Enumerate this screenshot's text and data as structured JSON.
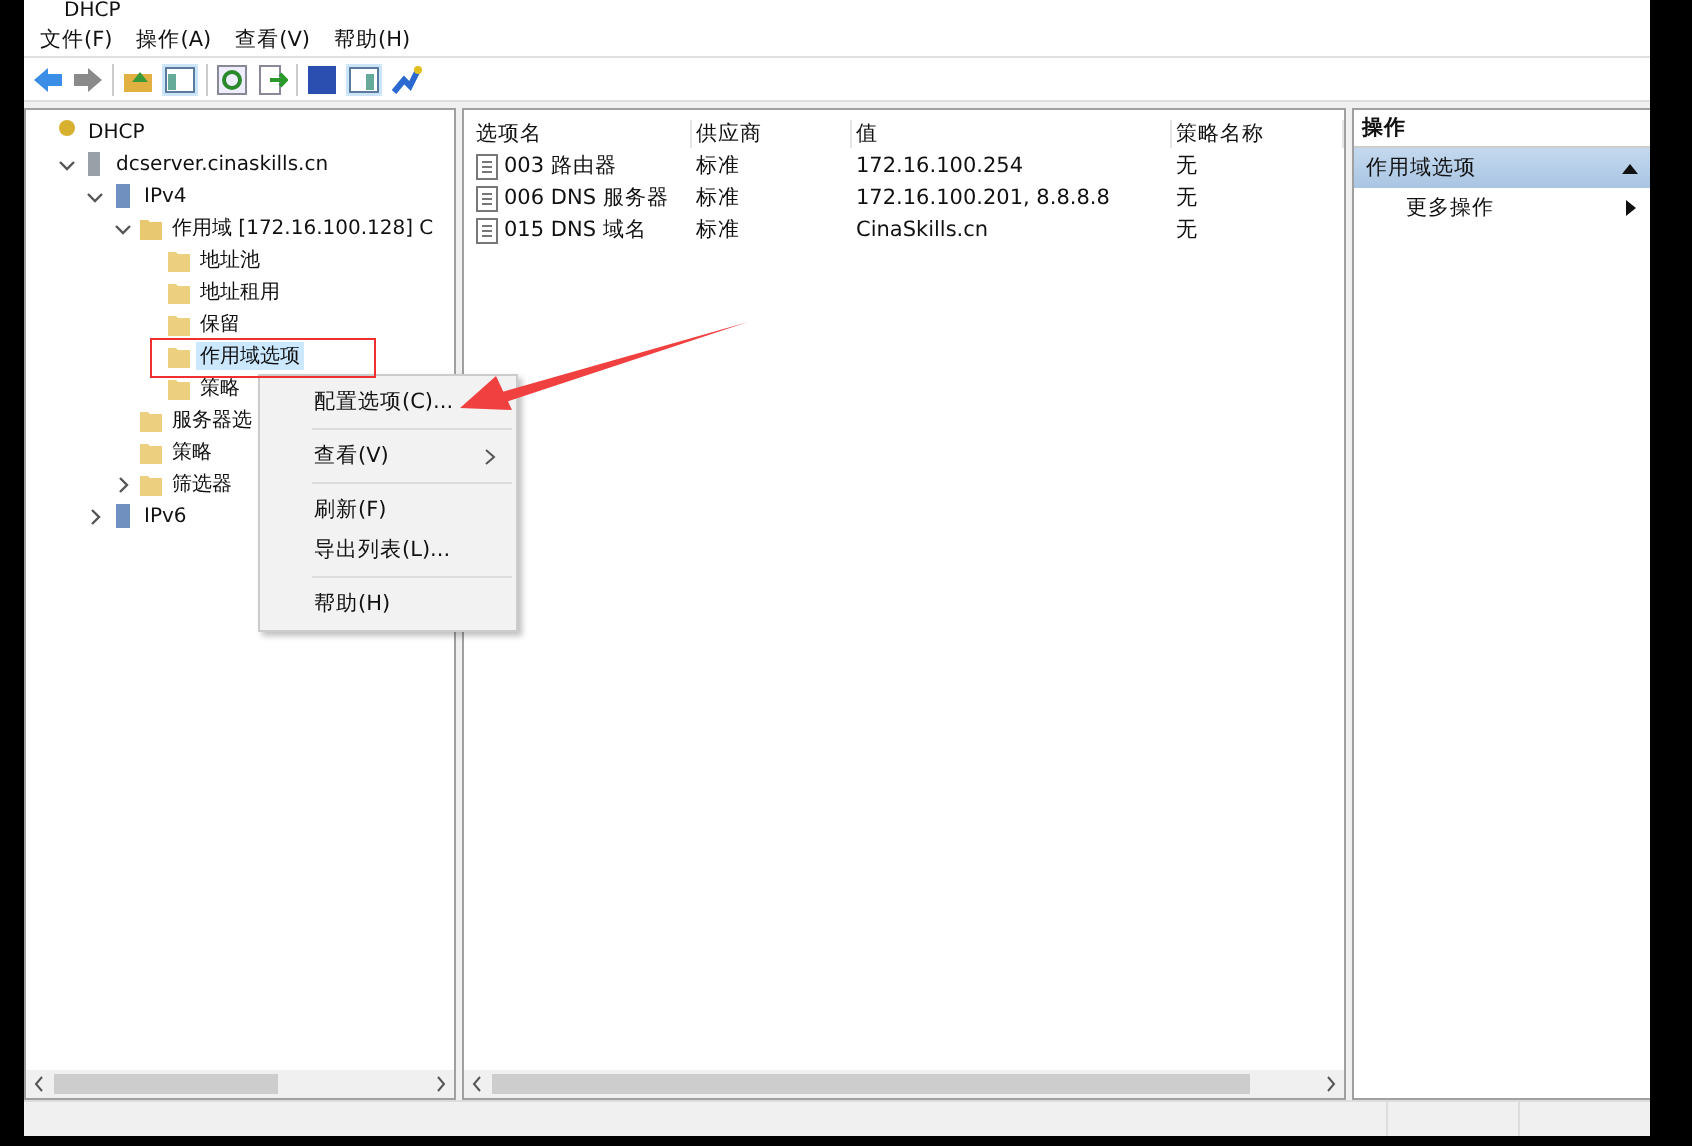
{
  "window": {
    "title": "DHCP"
  },
  "menu": [
    "文件(F)",
    "操作(A)",
    "查看(V)",
    "帮助(H)"
  ],
  "tree": [
    {
      "label": "DHCP",
      "kind": "root",
      "selected": false,
      "children": [
        {
          "label": "dcserver.cinaskills.cn",
          "kind": "server",
          "selected": false,
          "expanded": true,
          "children": [
            {
              "label": "IPv4",
              "kind": "protocol",
              "selected": false,
              "expanded": true,
              "children": [
                {
                  "label": "作用域 [172.16.100.128] C",
                  "kind": "scope",
                  "selected": false,
                  "expanded": true,
                  "children": [
                    {
                      "label": "地址池",
                      "kind": "folder",
                      "selected": false
                    },
                    {
                      "label": "地址租用",
                      "kind": "folder",
                      "selected": false
                    },
                    {
                      "label": "保留",
                      "kind": "folder",
                      "selected": false
                    },
                    {
                      "label": "作用域选项",
                      "kind": "folder",
                      "selected": true
                    },
                    {
                      "label": "策略",
                      "kind": "folder",
                      "selected": false
                    }
                  ]
                },
                {
                  "label": "服务器选",
                  "kind": "folder",
                  "selected": false
                },
                {
                  "label": "策略",
                  "kind": "folder",
                  "selected": false
                },
                {
                  "label": "筛选器",
                  "kind": "folder",
                  "selected": false,
                  "expanded": false
                }
              ]
            },
            {
              "label": "IPv6",
              "kind": "protocol",
              "selected": false,
              "expanded": false
            }
          ]
        }
      ]
    }
  ],
  "table": {
    "columns": [
      "选项名",
      "供应商",
      "值",
      "策略名称"
    ],
    "rows": [
      [
        "003 路由器",
        "标准",
        "172.16.100.254",
        "无"
      ],
      [
        "006 DNS 服务器",
        "标准",
        "172.16.100.201, 8.8.8.8",
        "无"
      ],
      [
        "015 DNS 域名",
        "标准",
        "CinaSkills.cn",
        "无"
      ]
    ]
  },
  "actions": {
    "title": "操作",
    "section": "作用域选项",
    "items": [
      "更多操作"
    ]
  },
  "context_menu": [
    {
      "kind": "item",
      "label": "配置选项(C)...",
      "submenu": false
    },
    {
      "kind": "separator"
    },
    {
      "kind": "item",
      "label": "查看(V)",
      "submenu": true
    },
    {
      "kind": "separator"
    },
    {
      "kind": "item",
      "label": "刷新(F)",
      "submenu": false
    },
    {
      "kind": "item",
      "label": "导出列表(L)...",
      "submenu": false
    },
    {
      "kind": "separator"
    },
    {
      "kind": "item",
      "label": "帮助(H)",
      "submenu": false
    }
  ]
}
